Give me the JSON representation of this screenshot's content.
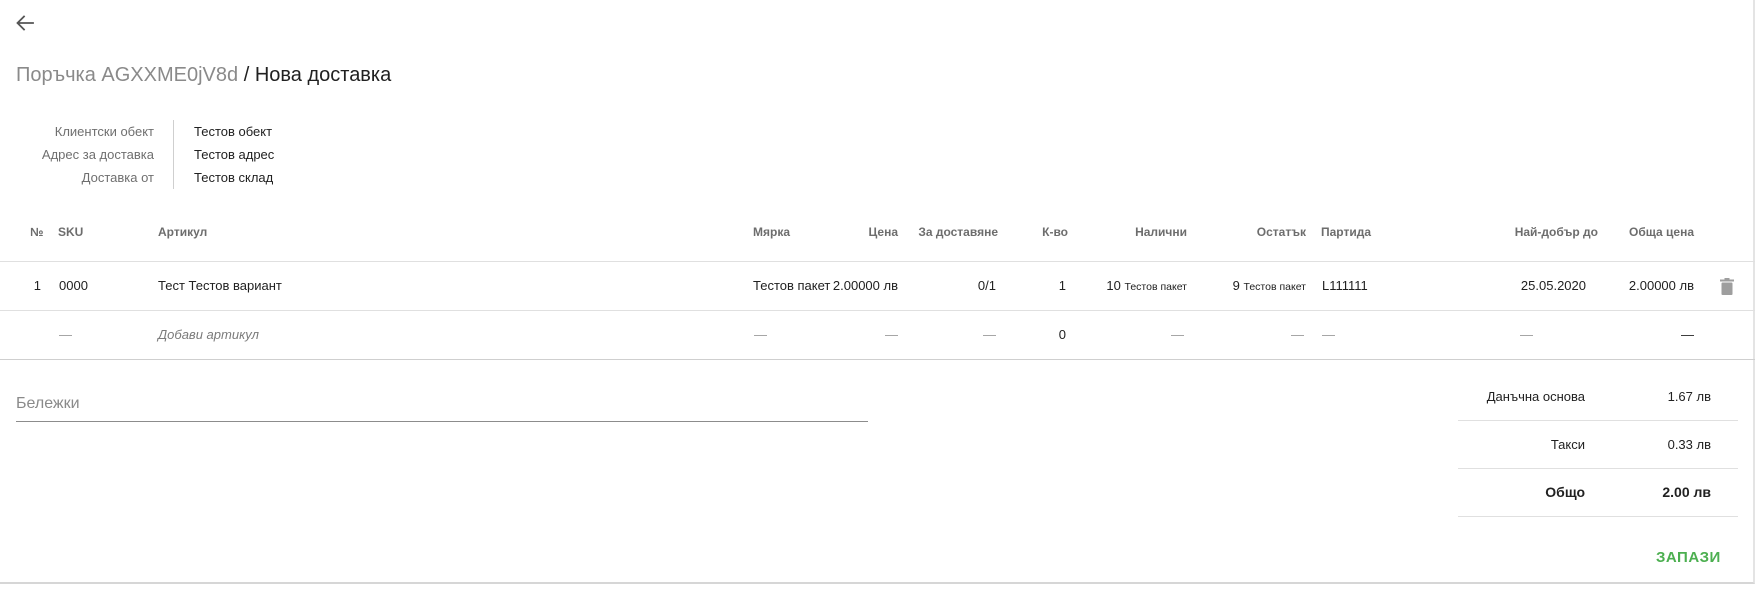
{
  "header": {
    "back_icon": "arrow-left-icon",
    "title_prefix": "Поръчка AGXXME0jV8d",
    "title_separator": " / ",
    "title_main": "Нова доставка"
  },
  "info": {
    "rows": [
      {
        "label": "Клиентски обект",
        "value": "Тестов обект"
      },
      {
        "label": "Адрес за доставка",
        "value": "Тестов адрес"
      },
      {
        "label": "Доставка от",
        "value": "Тестов склад"
      }
    ]
  },
  "table": {
    "headers": {
      "num": "№",
      "sku": "SKU",
      "article": "Артикул",
      "unit": "Мярка",
      "price": "Цена",
      "to_deliver": "За доставяне",
      "qty": "К-во",
      "available": "Налични",
      "remaining": "Остатък",
      "batch": "Партида",
      "best_before": "Най-добър до",
      "total_price": "Обща цена"
    },
    "rows": [
      {
        "num": "1",
        "sku": "0000",
        "article": "Тест Тестов вариант",
        "unit": "Тестов пакет",
        "price": "2.00000 лв",
        "to_deliver": "0/1",
        "qty": "1",
        "available_num": "10",
        "available_unit": "Тестов пакет",
        "remaining_num": "9",
        "remaining_unit": "Тестов пакет",
        "batch": "L111111",
        "best_before": "25.05.2020",
        "total_price": "2.00000 лв",
        "delete_icon": "trash-icon"
      }
    ],
    "add_row": {
      "sku": "—",
      "article": "Добави артикул",
      "unit": "—",
      "price": "—",
      "to_deliver": "—",
      "qty": "0",
      "available": "—",
      "remaining": "—",
      "batch": "—",
      "best_before": "—",
      "total_price": "—"
    }
  },
  "notes": {
    "placeholder": "Бележки"
  },
  "totals": {
    "tax_base_label": "Данъчна основа",
    "tax_base_value": "1.67 лв",
    "taxes_label": "Такси",
    "taxes_value": "0.33 лв",
    "total_label": "Общо",
    "total_value": "2.00 лв"
  },
  "actions": {
    "save_label": "ЗАПАЗИ"
  },
  "colors": {
    "accent": "#4caf50"
  }
}
